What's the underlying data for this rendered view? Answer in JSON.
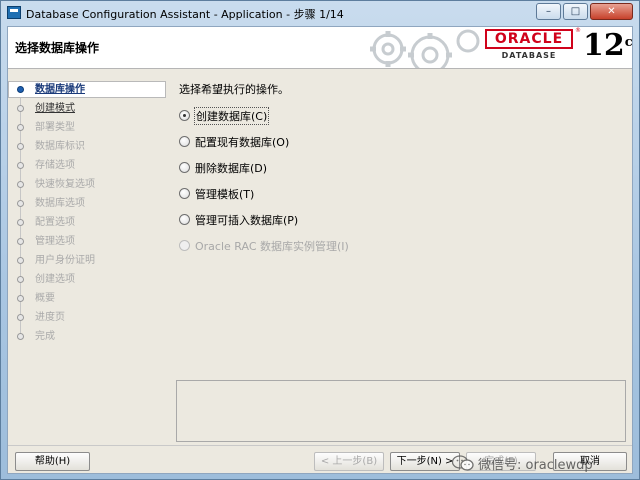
{
  "window": {
    "title": "Database Configuration Assistant - Application - 步骤 1/14",
    "controls": {
      "minimize": "–",
      "maximize": "□",
      "close": "✕"
    }
  },
  "header": {
    "title": "选择数据库操作",
    "logo": {
      "brand": "ORACLE",
      "registered": "®",
      "product": "DATABASE",
      "version": "12",
      "version_suffix": "c"
    }
  },
  "steps": [
    {
      "label": "数据库操作",
      "state": "current"
    },
    {
      "label": "创建模式",
      "state": "active"
    },
    {
      "label": "部署类型",
      "state": "disabled"
    },
    {
      "label": "数据库标识",
      "state": "disabled"
    },
    {
      "label": "存储选项",
      "state": "disabled"
    },
    {
      "label": "快速恢复选项",
      "state": "disabled"
    },
    {
      "label": "数据库选项",
      "state": "disabled"
    },
    {
      "label": "配置选项",
      "state": "disabled"
    },
    {
      "label": "管理选项",
      "state": "disabled"
    },
    {
      "label": "用户身份证明",
      "state": "disabled"
    },
    {
      "label": "创建选项",
      "state": "disabled"
    },
    {
      "label": "概要",
      "state": "disabled"
    },
    {
      "label": "进度页",
      "state": "disabled"
    },
    {
      "label": "完成",
      "state": "disabled"
    }
  ],
  "content": {
    "prompt": "选择希望执行的操作。",
    "options": [
      {
        "label": "创建数据库(C)",
        "selected": true,
        "enabled": true
      },
      {
        "label": "配置现有数据库(O)",
        "selected": false,
        "enabled": true
      },
      {
        "label": "删除数据库(D)",
        "selected": false,
        "enabled": true
      },
      {
        "label": "管理模板(T)",
        "selected": false,
        "enabled": true
      },
      {
        "label": "管理可插入数据库(P)",
        "selected": false,
        "enabled": true
      },
      {
        "label": "Oracle RAC 数据库实例管理(I)",
        "selected": false,
        "enabled": false
      }
    ]
  },
  "buttons": {
    "help": "帮助(H)",
    "back": "< 上一步(B)",
    "next": "下一步(N) >",
    "finish": "完成(F)",
    "cancel": "取消"
  },
  "watermark": {
    "text": "微信号: oraclewdp"
  }
}
